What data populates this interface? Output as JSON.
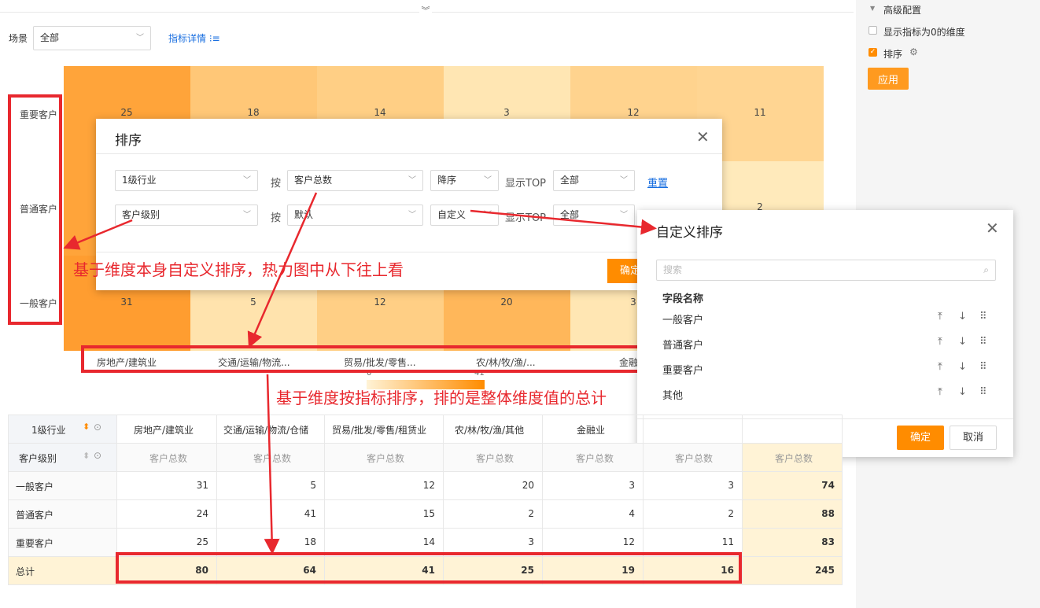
{
  "toolbar": {
    "scene_label": "场景",
    "scene_value": "全部",
    "metric_detail": "指标详情 ⁝≡"
  },
  "right_panel": {
    "title": "高级配置",
    "opt_zero": "显示指标为0的维度",
    "opt_sort": "排序",
    "apply": "应用"
  },
  "heatmap": {
    "rows": [
      "重要客户",
      "普通客户",
      "一般客户"
    ],
    "cols": [
      "房地产/建筑业",
      "交通/运输/物流...",
      "贸易/批发/零售...",
      "农/林/牧/渔/...",
      "金融"
    ],
    "visible_values": {
      "top_row": [
        "25",
        "18",
        "14",
        "3",
        "12",
        "11"
      ],
      "mid_right": "2",
      "bottom_row": [
        "31",
        "5",
        "12",
        "20",
        "3"
      ]
    },
    "legend_min": "0",
    "legend_max": "41"
  },
  "sort_dialog": {
    "title": "排序",
    "row1": {
      "dim": "1级行业",
      "by": "按",
      "metric": "客户总数",
      "order": "降序",
      "top_label": "显示TOP",
      "top_value": "全部",
      "reset": "重置"
    },
    "row2": {
      "dim": "客户级别",
      "by": "按",
      "metric": "默认",
      "order": "自定义",
      "top_label": "显示TOP",
      "top_value": "全部"
    },
    "confirm": "确定"
  },
  "custom_dialog": {
    "title": "自定义排序",
    "search_placeholder": "搜索",
    "field_header": "字段名称",
    "items": [
      "一般客户",
      "普通客户",
      "重要客户",
      "其他"
    ],
    "confirm": "确定",
    "cancel": "取消"
  },
  "annotations": {
    "a1": "基于维度本身自定义排序，热力图中从下往上看",
    "a2": "基于维度按指标排序，排的是整体维度值的总计"
  },
  "pivot": {
    "corner_col": "1级行业",
    "corner_row": "客户级别",
    "headers": [
      "房地产/建筑业",
      "交通/运输/物流/仓储",
      "贸易/批发/零售/租赁业",
      "农/林/牧/渔/其他",
      "金融业"
    ],
    "sub_headers": [
      "客户总数",
      "客户总数",
      "客户总数",
      "客户总数",
      "客户总数",
      "客户总数",
      "客户总数"
    ],
    "rows": [
      {
        "label": "一般客户",
        "values": [
          "31",
          "5",
          "12",
          "20",
          "3",
          "3"
        ],
        "total": "74"
      },
      {
        "label": "普通客户",
        "values": [
          "24",
          "41",
          "15",
          "2",
          "4",
          "2"
        ],
        "total": "88"
      },
      {
        "label": "重要客户",
        "values": [
          "25",
          "18",
          "14",
          "3",
          "12",
          "11"
        ],
        "total": "83"
      },
      {
        "label": "总计",
        "values": [
          "80",
          "64",
          "41",
          "25",
          "19",
          "16"
        ],
        "total": "245"
      }
    ]
  }
}
